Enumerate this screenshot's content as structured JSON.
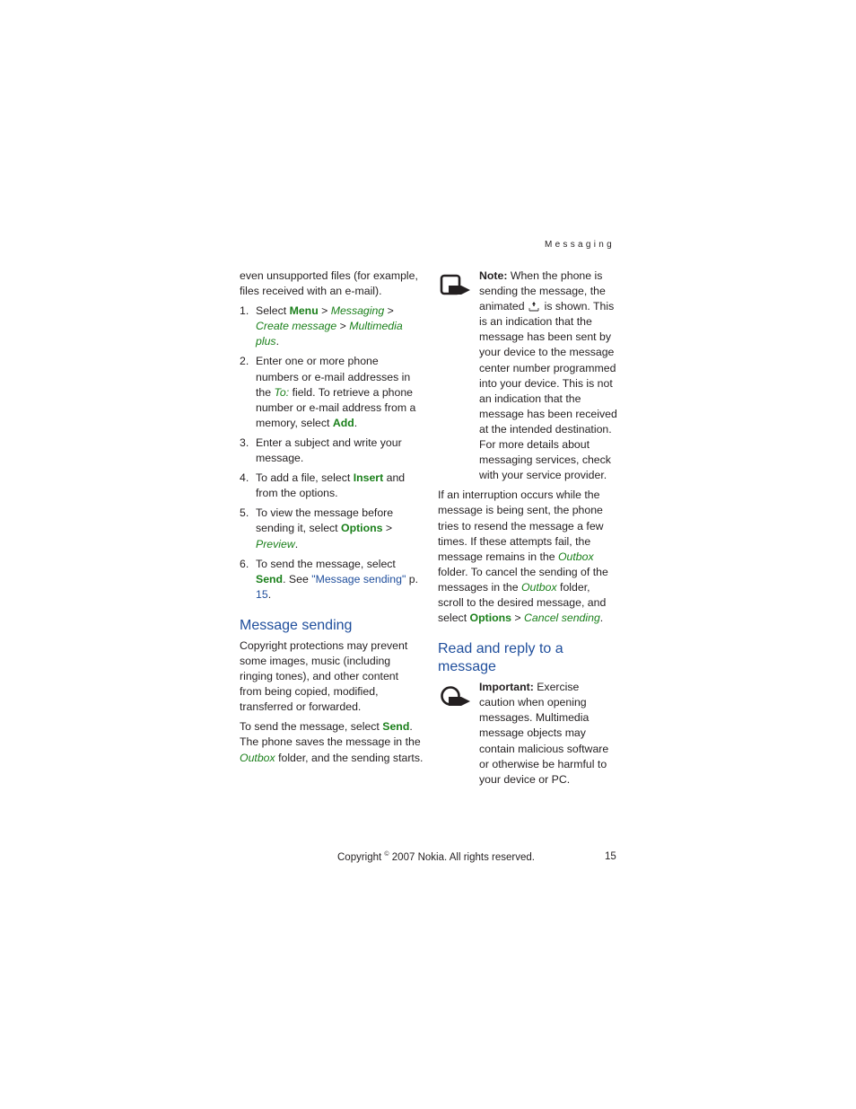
{
  "header": {
    "section_title": "Messaging"
  },
  "left_column": {
    "intro": "even unsupported files (for example, files received with an e-mail).",
    "steps": [
      {
        "num": "1.",
        "pre": "Select ",
        "menu": "Menu",
        "sep1": " > ",
        "i1": "Messaging",
        "sep2": " > ",
        "i2": "Create message",
        "sep3": " > ",
        "i3": "Multimedia plus",
        "post": "."
      },
      {
        "num": "2.",
        "pre": "Enter one or more phone numbers or e-mail addresses in the ",
        "field": "To:",
        "mid": " field. To retrieve a phone number or e-mail address from a memory, select ",
        "action": "Add",
        "post": "."
      },
      {
        "num": "3.",
        "text": "Enter a subject and write your message."
      },
      {
        "num": "4.",
        "pre": "To add a file, select ",
        "action": "Insert",
        "post": " and from the options."
      },
      {
        "num": "5.",
        "pre": "To view the message before sending it, select ",
        "action": "Options",
        "sep": " > ",
        "item": "Preview",
        "post": "."
      },
      {
        "num": "6.",
        "pre": "To send the message, select ",
        "action": "Send",
        "mid": ". See ",
        "link": "\"Message sending\"",
        "mid2": " p. ",
        "page": "15",
        "post": "."
      }
    ],
    "section_heading": "Message sending",
    "para1": "Copyright protections may prevent some images, music (including ringing tones), and other content from being copied, modified, transferred or forwarded.",
    "para2_pre": "To send the message, select ",
    "para2_action": "Send",
    "para2_mid": ". The phone saves the message in the ",
    "para2_folder": "Outbox",
    "para2_post": " folder, and the sending starts."
  },
  "right_column": {
    "note": {
      "label": "Note:",
      "pre": " When the phone is sending the message, the animated",
      "post": "is shown. This is an indication that the message has been sent by your device to the message center number programmed into your device. This is not an indication that the message has been received at the intended destination. For more details about messaging services, check with your service provider.",
      "icon": "note-hand-icon",
      "inline_icon": "message-sending-icon"
    },
    "para": {
      "pre": "If an interruption occurs while the message is being sent, the phone tries to resend the message a few times. If these attempts fail, the message remains in the ",
      "folder1": "Outbox",
      "mid": " folder. To cancel the sending of the messages in the ",
      "folder2": "Outbox",
      "mid2": " folder, scroll to the desired message, and select ",
      "action": "Options",
      "sep": " > ",
      "item": "Cancel sending",
      "post": "."
    },
    "section_heading": "Read and reply to a message",
    "important": {
      "label": "Important:",
      "text": " Exercise caution when opening messages. Multimedia message objects may contain malicious software or otherwise be harmful to your device or PC.",
      "icon": "important-hand-icon"
    }
  },
  "footer": {
    "copyright_pre": "Copyright ",
    "copyright_symbol": "©",
    "copyright_post": " 2007 Nokia. All rights reserved.",
    "page_number": "15"
  },
  "colors": {
    "text": "#231f20",
    "menu_green": "#1a7f1a",
    "heading_blue": "#1f4e9c"
  }
}
